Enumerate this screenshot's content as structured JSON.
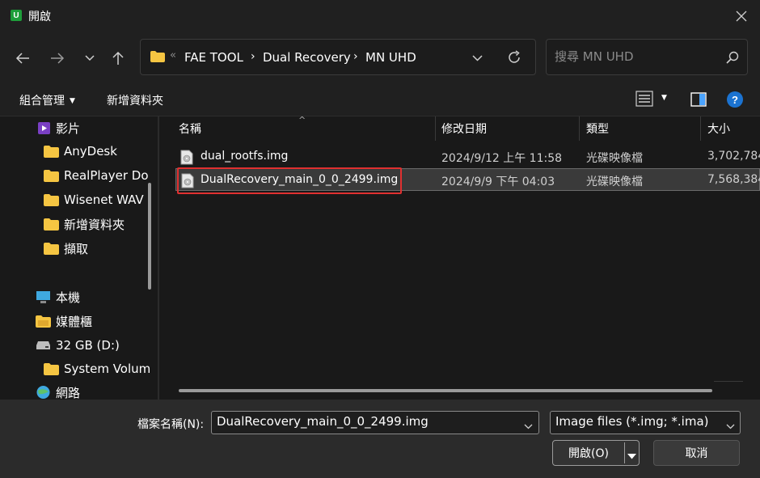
{
  "window": {
    "title": "開啟",
    "app_icon_letter": "U"
  },
  "address": {
    "crumbs": [
      "FAE TOOL",
      "Dual Recovery",
      "MN UHD"
    ]
  },
  "search": {
    "placeholder": "搜尋 MN UHD"
  },
  "toolbar": {
    "organize_label": "組合管理",
    "new_folder_label": "新增資料夾",
    "help_label": "?"
  },
  "sidebar": {
    "items": [
      {
        "label": "影片",
        "icon": "video-icon"
      },
      {
        "label": "AnyDesk",
        "icon": "folder-icon"
      },
      {
        "label": "RealPlayer Do",
        "icon": "folder-icon"
      },
      {
        "label": "Wisenet WAV",
        "icon": "folder-icon"
      },
      {
        "label": "新增資料夾",
        "icon": "folder-icon"
      },
      {
        "label": "擷取",
        "icon": "folder-icon"
      },
      {
        "label": "本機",
        "icon": "computer-icon"
      },
      {
        "label": "媒體櫃",
        "icon": "library-icon"
      },
      {
        "label": "32 GB (D:)",
        "icon": "drive-icon"
      },
      {
        "label": "System Volum",
        "icon": "folder-icon"
      },
      {
        "label": "網路",
        "icon": "network-icon"
      }
    ]
  },
  "filelist": {
    "columns": [
      "名稱",
      "修改日期",
      "類型",
      "大小"
    ],
    "rows": [
      {
        "name": "dual_rootfs.img",
        "date": "2024/9/12 上午 11:58",
        "type": "光碟映像檔",
        "size": "3,702,784"
      },
      {
        "name": "DualRecovery_main_0_0_2499.img",
        "date": "2024/9/9 下午 04:03",
        "type": "光碟映像檔",
        "size": "7,568,384"
      }
    ],
    "selected_index": 1
  },
  "bottom": {
    "filename_label": "檔案名稱(N):",
    "filename_value": "DualRecovery_main_0_0_2499.img",
    "filter_value": "Image files (*.img; *.ima)",
    "open_label": "開啟(O)",
    "cancel_label": "取消"
  },
  "colors": {
    "background": "#202020",
    "pane": "#191919",
    "bottom": "#2b2b2b",
    "folder": "#f5c542",
    "highlight": "#e03030",
    "accent": "#1b73d1"
  }
}
